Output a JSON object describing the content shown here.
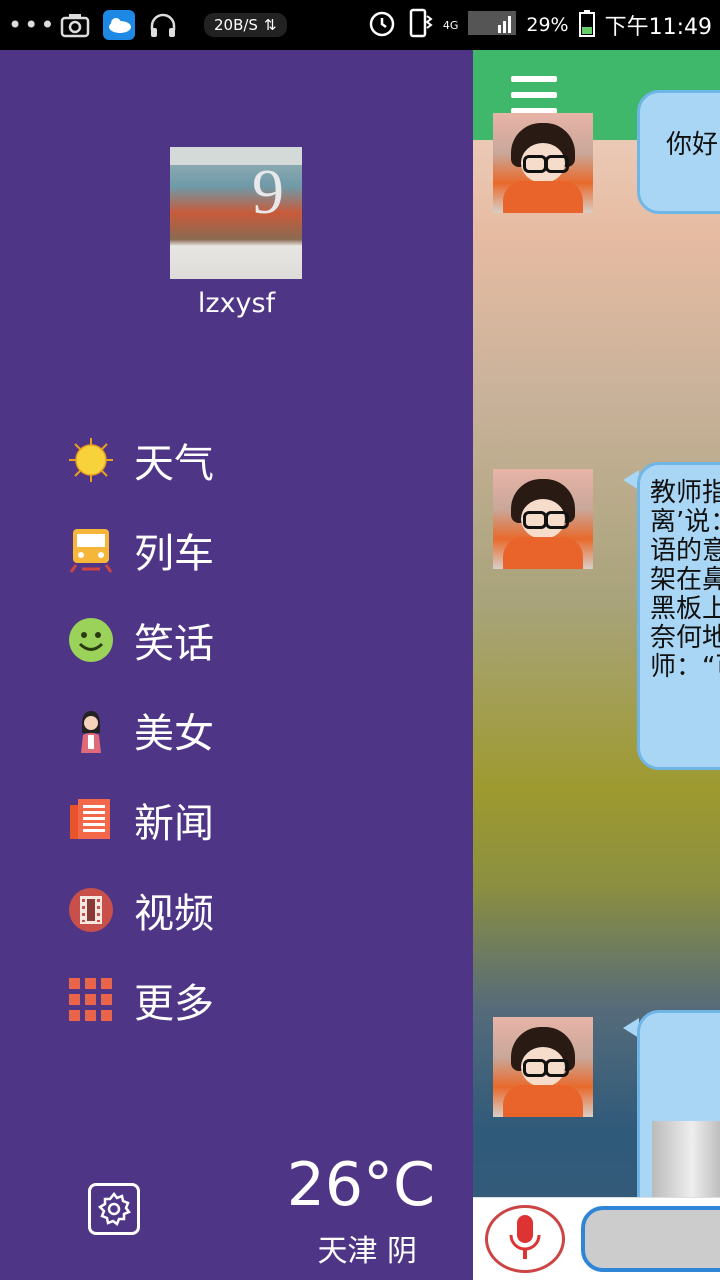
{
  "status_bar": {
    "net_speed": "20B/S",
    "network": "4G",
    "battery": "29%",
    "time": "下午11:49"
  },
  "drawer": {
    "username": "lzxysf",
    "profile_image_text": "9",
    "menu": [
      {
        "label": "天气",
        "icon": "sun-icon"
      },
      {
        "label": "列车",
        "icon": "train-icon"
      },
      {
        "label": "笑话",
        "icon": "smiley-icon"
      },
      {
        "label": "美女",
        "icon": "woman-icon"
      },
      {
        "label": "新闻",
        "icon": "newspaper-icon"
      },
      {
        "label": "视频",
        "icon": "film-icon"
      },
      {
        "label": "更多",
        "icon": "grid-icon"
      }
    ],
    "weather": {
      "temperature": "26°C",
      "city_condition": "天津 阴"
    }
  },
  "chat": {
    "messages": [
      {
        "text": "你好"
      },
      {
        "lines": [
          "教师指",
          "离’说：",
          "语的意",
          "架在鼻",
          "黑板上",
          "奈何地",
          "师：“可"
        ]
      },
      {
        "text": ""
      }
    ]
  },
  "colors": {
    "drawer_bg": "#4f3585",
    "appbar": "#3fb86c",
    "bubble": "#a9d6f5"
  }
}
